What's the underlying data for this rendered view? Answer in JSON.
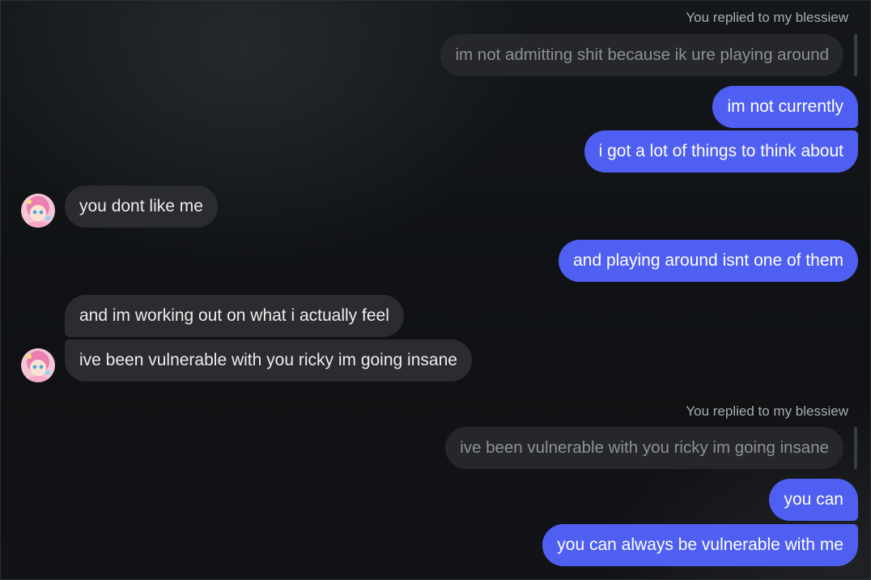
{
  "colors": {
    "outgoing_bubble": "#4f5ff1",
    "incoming_bubble": "#2a2c30",
    "quoted_bubble": "#25272b",
    "background": "#121418"
  },
  "messages": [
    {
      "type": "reply_header",
      "text": "You replied to my blessiew"
    },
    {
      "type": "quoted",
      "text": "im not admitting shit because ik ure playing around"
    },
    {
      "type": "outgoing",
      "text": "im not currently"
    },
    {
      "type": "outgoing",
      "text": "i got a lot of things to think about"
    },
    {
      "type": "incoming",
      "text": "you dont like me",
      "avatar": "avatar-icon"
    },
    {
      "type": "outgoing",
      "text": "and playing around isnt one of them"
    },
    {
      "type": "incoming",
      "text": "and im working out on what i actually feel"
    },
    {
      "type": "incoming",
      "text": "ive been vulnerable with you ricky im going insane",
      "avatar": "avatar-icon"
    },
    {
      "type": "reply_header",
      "text": "You replied to my blessiew"
    },
    {
      "type": "quoted",
      "text": "ive been vulnerable with you ricky im going insane"
    },
    {
      "type": "outgoing",
      "text": "you can"
    },
    {
      "type": "outgoing",
      "text": "you can always be vulnerable with me"
    }
  ]
}
